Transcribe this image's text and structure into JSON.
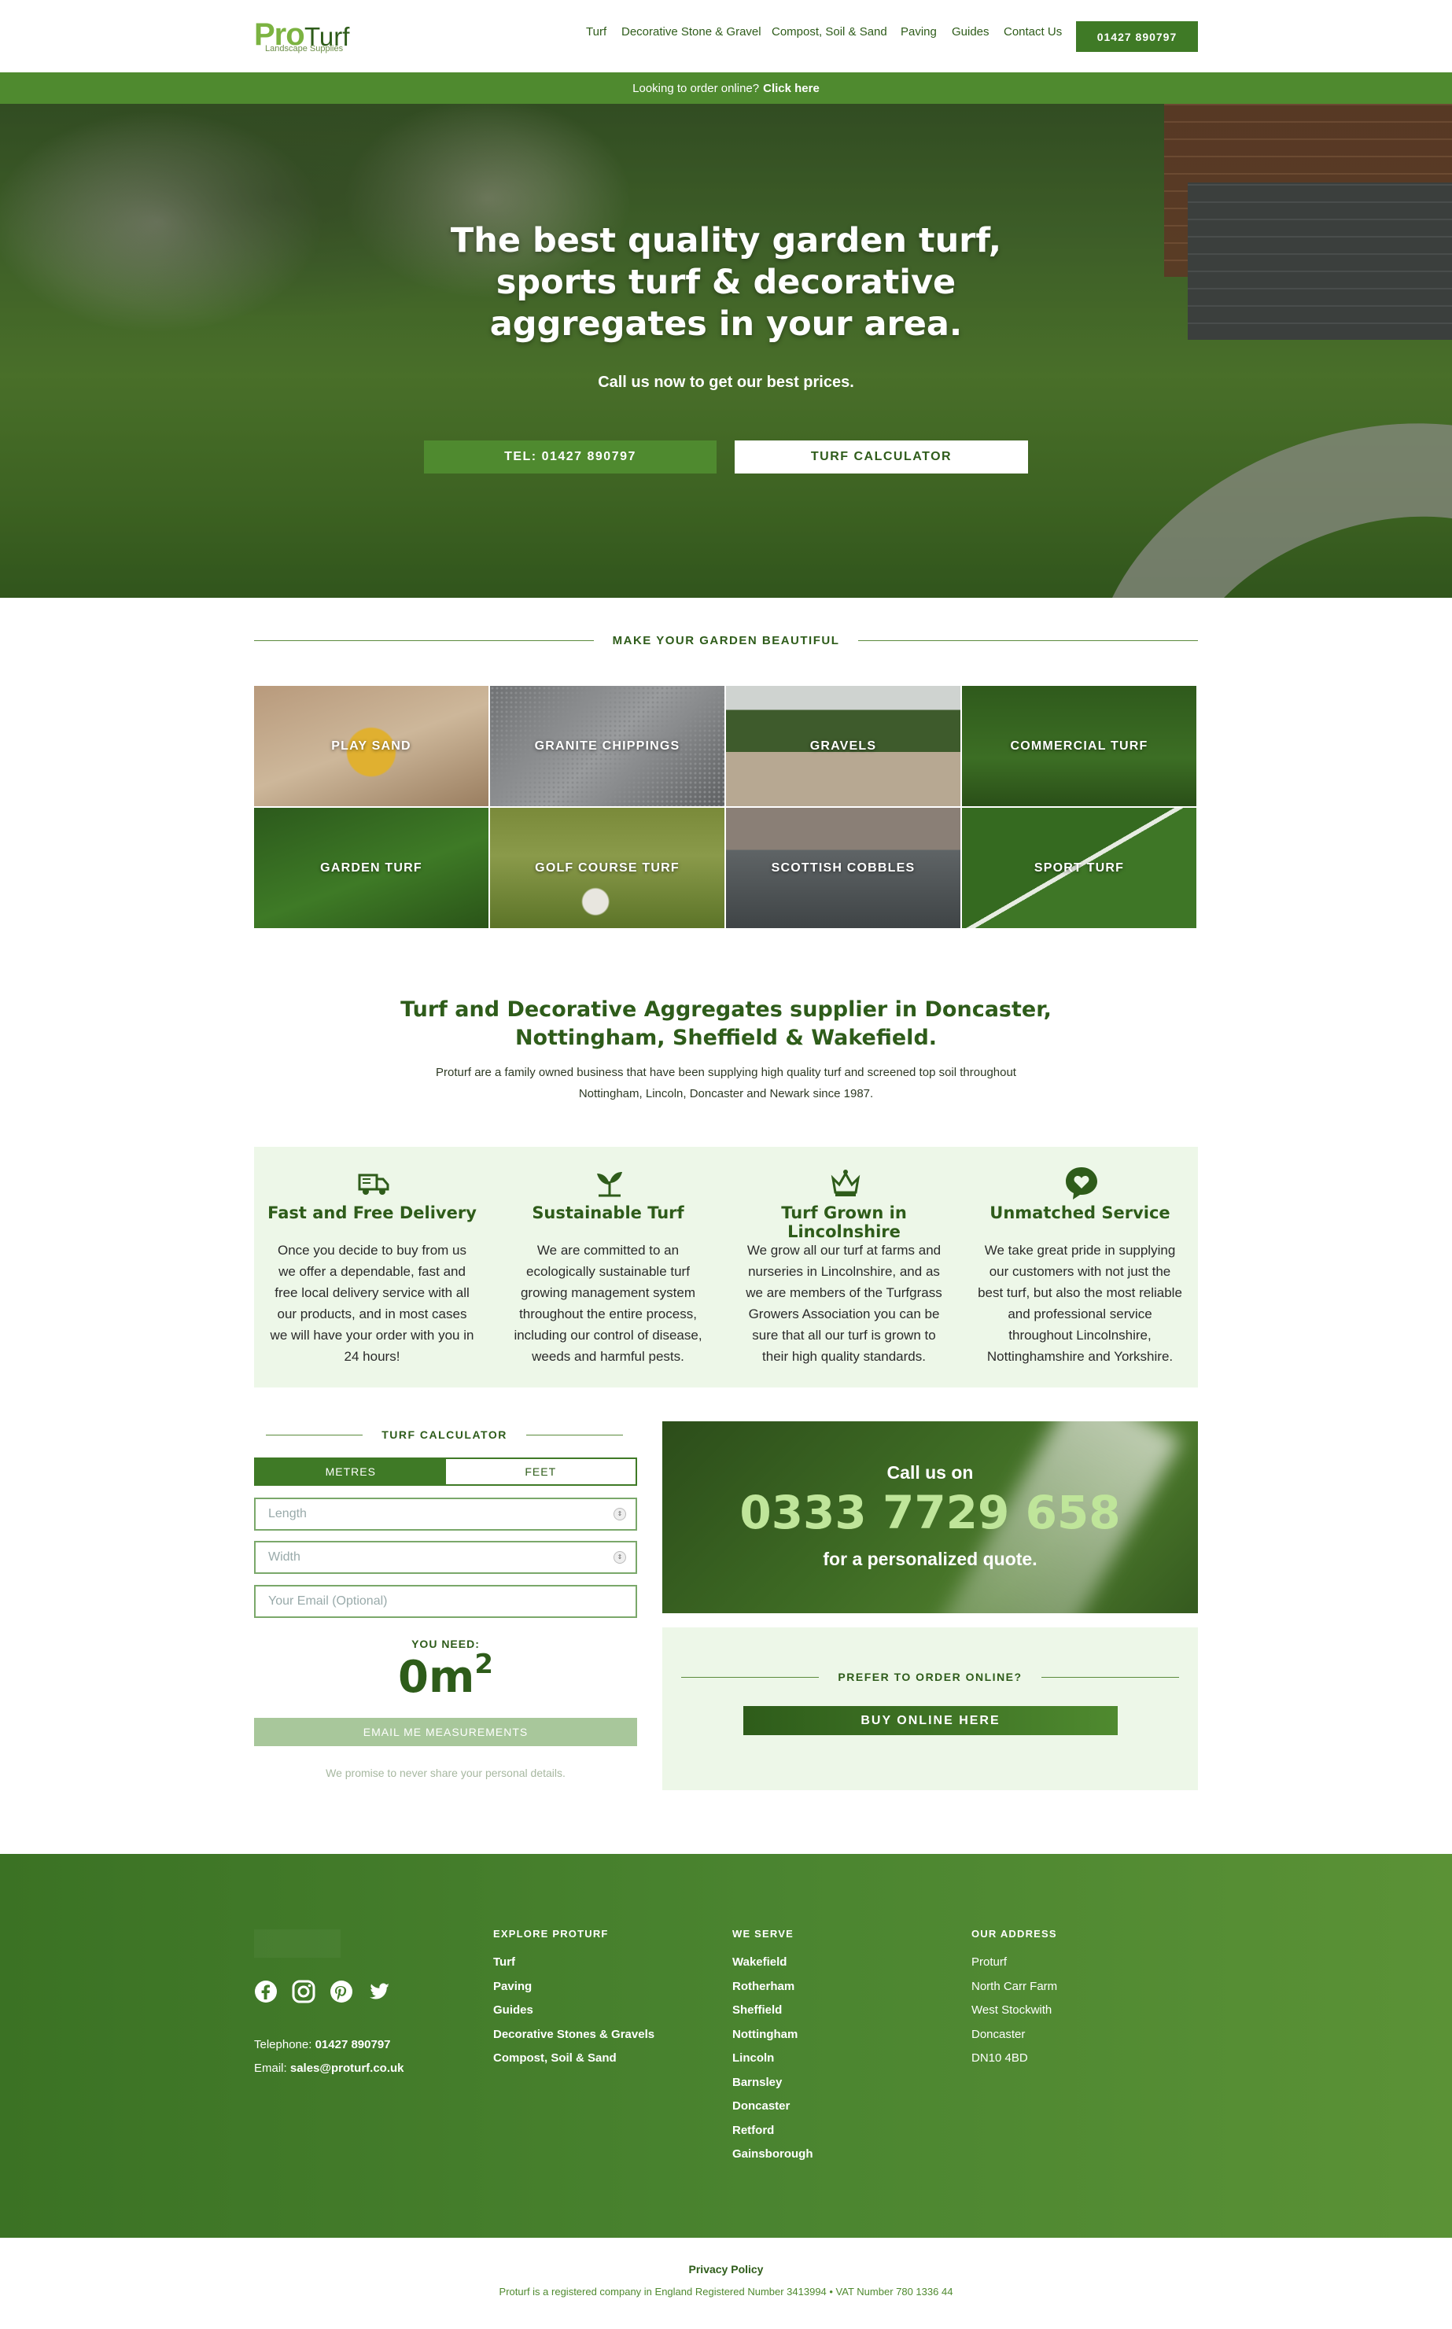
{
  "header": {
    "logo_pro": "Pro",
    "logo_turf": "Turf",
    "logo_sub": "Landscape Supplies",
    "nav": [
      "Turf",
      "Decorative Stone & Gravel",
      "Compost, Soil & Sand",
      "Paving",
      "Guides",
      "Contact Us"
    ],
    "phone": "01427 890797"
  },
  "order_bar": {
    "text": "Looking to order online?",
    "link": "Click here"
  },
  "hero": {
    "title": "The best quality garden turf, sports turf & decorative aggregates in your area.",
    "subtitle": "Call us now to get our best prices.",
    "btn_tel": "TEL: 01427 890797",
    "btn_calc": "TURF CALCULATOR"
  },
  "section_beautiful": "MAKE YOUR GARDEN BEAUTIFUL",
  "tiles": [
    "PLAY SAND",
    "GRANITE CHIPPINGS",
    "GRAVELS",
    "COMMERCIAL TURF",
    "GARDEN TURF",
    "GOLF COURSE TURF",
    "SCOTTISH COBBLES",
    "SPORT TURF"
  ],
  "intro": {
    "heading": "Turf and Decorative Aggregates supplier in Doncaster, Nottingham, Sheffield & Wakefield.",
    "text": "Proturf are a family owned business that have been supplying high quality turf and screened top soil throughout Nottingham, Lincoln, Doncaster and Newark since 1987."
  },
  "features": [
    {
      "icon": "delivery-truck-icon",
      "title": "Fast and Free Delivery",
      "text": "Once you decide to buy from us we offer a dependable, fast and free local delivery service with all our products, and in most cases we will have your order with you in 24 hours!"
    },
    {
      "icon": "leaf-sprout-icon",
      "title": "Sustainable Turf",
      "text": "We are committed to an ecologically sustainable turf growing management system throughout the entire process, including our control of disease, weeds and harmful pests."
    },
    {
      "icon": "crown-icon",
      "title": "Turf Grown in Lincolnshire",
      "text": "We grow all our turf at farms and nurseries in Lincolnshire, and as we are members of the Turfgrass Growers Association you can be sure that all our turf is grown to their high quality standards."
    },
    {
      "icon": "heart-chat-icon",
      "title": "Unmatched Service",
      "text": "We take great pride in supplying our customers with not just the best turf, but also the most reliable and professional service throughout Lincolnshire, Nottinghamshire and Yorkshire."
    }
  ],
  "calculator": {
    "heading": "TURF CALCULATOR",
    "tab_metres": "METRES",
    "tab_feet": "FEET",
    "length_placeholder": "Length",
    "width_placeholder": "Width",
    "email_placeholder": "Your Email (Optional)",
    "you_need": "YOU NEED:",
    "area_value": "0m",
    "area_unit_sup": "2",
    "email_btn": "EMAIL ME MEASUREMENTS",
    "promise": "We promise to never share your personal details."
  },
  "callbox": {
    "line1": "Call us on",
    "number": "0333 7729 658",
    "line3": "for a personalized quote."
  },
  "orderbox": {
    "heading": "PREFER TO ORDER ONLINE?",
    "button": "BUY ONLINE HERE"
  },
  "footer": {
    "social": [
      "facebook-icon",
      "instagram-icon",
      "pinterest-icon",
      "twitter-icon"
    ],
    "telephone_label": "Telephone:",
    "telephone": "01427 890797",
    "email_label": "Email:",
    "email": "sales@proturf.co.uk",
    "explore_heading": "EXPLORE PROTURF",
    "explore": [
      "Turf",
      "Paving",
      "Guides",
      "Decorative Stones & Gravels",
      "Compost, Soil & Sand"
    ],
    "serve_heading": "WE SERVE",
    "serve": [
      "Wakefield",
      "Rotherham",
      "Sheffield",
      "Nottingham",
      "Lincoln",
      "Barnsley",
      "Doncaster",
      "Retford",
      "Gainsborough"
    ],
    "address_heading": "OUR ADDRESS",
    "address": [
      "Proturf",
      "North Carr Farm",
      "West Stockwith",
      "Doncaster",
      "DN10 4BD"
    ]
  },
  "bottom": {
    "privacy": "Privacy Policy",
    "company": "Proturf is a registered company in England Registered Number 3413994 • VAT Number 780 1336 44"
  },
  "colors": {
    "brand_dark": "#2e5c1a",
    "brand": "#3f7a26",
    "brand_light": "#7cb342",
    "panel": "#edf7e8"
  }
}
